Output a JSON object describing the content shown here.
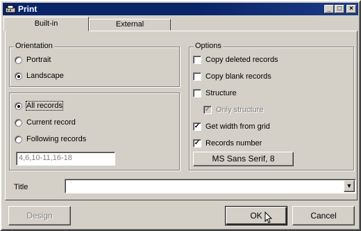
{
  "window": {
    "title": "Print"
  },
  "titlebar_buttons": {
    "minimize": "_",
    "maximize": "□",
    "close": "×"
  },
  "tabs": [
    {
      "label": "Built-in"
    },
    {
      "label": "External"
    }
  ],
  "orientation": {
    "legend": "Orientation",
    "options": [
      {
        "label": "Portrait",
        "selected": false
      },
      {
        "label": "Landscape",
        "selected": true
      }
    ]
  },
  "records": {
    "options": [
      {
        "label": "All records",
        "selected": true
      },
      {
        "label": "Current record",
        "selected": false
      },
      {
        "label": "Following records",
        "selected": false
      }
    ],
    "range_value": "4,6,10-11,16-18"
  },
  "options": {
    "legend": "Options",
    "items": [
      {
        "label": "Copy deleted records",
        "checked": false
      },
      {
        "label": "Copy blank records",
        "checked": false
      },
      {
        "label": "Structure",
        "checked": false
      },
      {
        "label": "Only structure",
        "checked": true,
        "disabled": true
      },
      {
        "label": "Get width from grid",
        "checked": true
      },
      {
        "label": "Records number",
        "checked": true
      }
    ],
    "font_button": "MS Sans Serif, 8"
  },
  "title_field": {
    "label": "Title",
    "value": ""
  },
  "footer": {
    "design": "Design",
    "ok": "OK",
    "cancel": "Cancel"
  }
}
